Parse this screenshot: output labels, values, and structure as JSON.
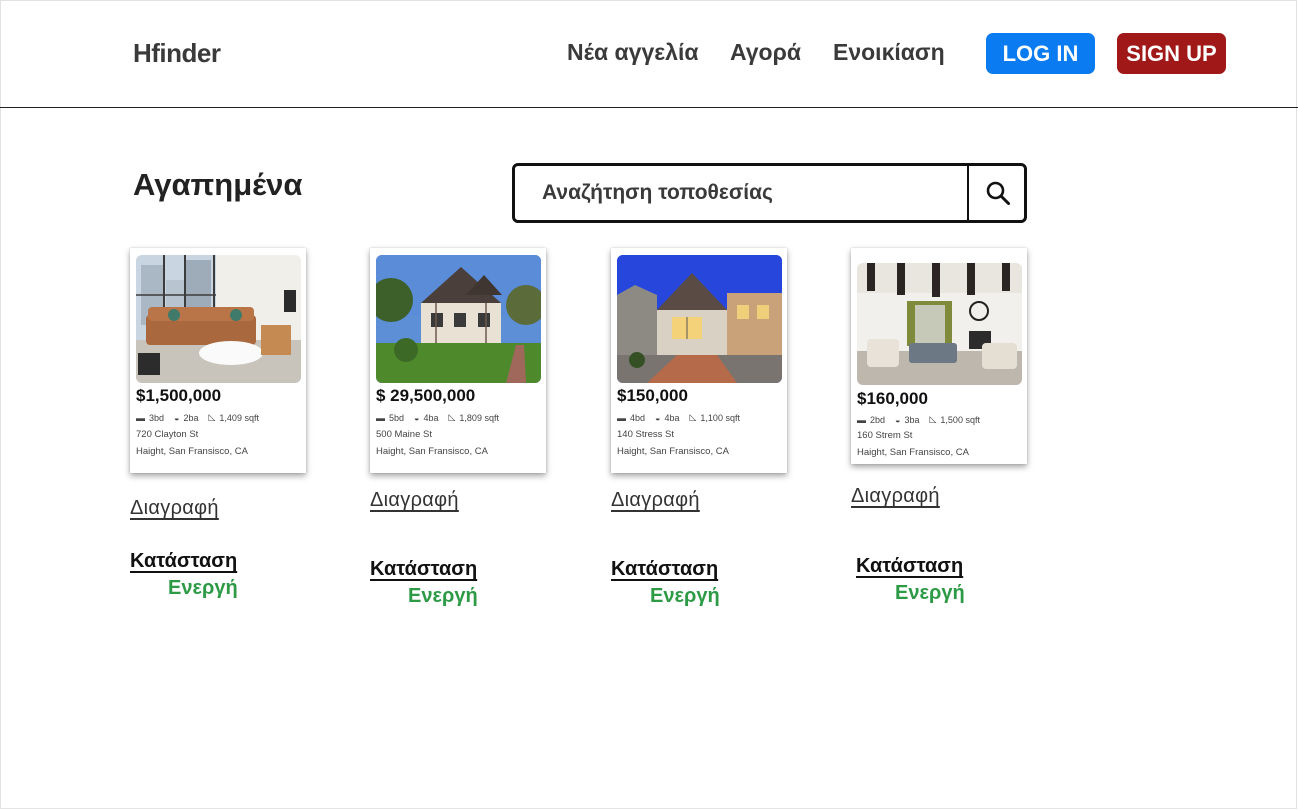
{
  "header": {
    "logo": "Hfinder",
    "nav": {
      "new_listing": "Νέα αγγελία",
      "buy": "Αγορά",
      "rent": "Ενοικίαση"
    },
    "login_label": "LOG IN",
    "signup_label": "SIGN UP",
    "colors": {
      "login": "#0a7bf0",
      "signup": "#a01818"
    }
  },
  "page": {
    "title": "Αγαπημένα"
  },
  "search": {
    "placeholder": "Αναζήτηση τοποθεσίας",
    "icon": "search-icon"
  },
  "listings": [
    {
      "price": "$1,500,000",
      "beds": "3bd",
      "baths": "2ba",
      "area": "1,409 sqft",
      "address": "720 Clayton St",
      "city": "Haight, San Fransisco, CA",
      "photo": "living-room-photo",
      "delete_label": "Διαγραφή",
      "status_label": "Κατάσταση",
      "status_value": "Ενεργή"
    },
    {
      "price": "$ 29,500,000",
      "beds": "5bd",
      "baths": "4ba",
      "area": "1,809 sqft",
      "address": "500 Maine St",
      "city": "Haight, San Fransisco, CA",
      "photo": "tudor-house-photo",
      "delete_label": "Διαγραφή",
      "status_label": "Κατάσταση",
      "status_value": "Ενεργή"
    },
    {
      "price": "$150,000",
      "beds": "4bd",
      "baths": "4ba",
      "area": "1,100 sqft",
      "address": "140 Stress St",
      "city": "Haight, San Fransisco, CA",
      "photo": "twilight-house-photo",
      "delete_label": "Διαγραφή",
      "status_label": "Κατάσταση",
      "status_value": "Ενεργή"
    },
    {
      "price": "$160,000",
      "beds": "2bd",
      "baths": "3ba",
      "area": "1,500 sqft",
      "address": "160 Strem St",
      "city": "Haight, San Fransisco, CA",
      "photo": "beamed-living-room-photo",
      "delete_label": "Διαγραφή",
      "status_label": "Κατάσταση",
      "status_value": "Ενεργή"
    }
  ],
  "colors": {
    "status_active": "#2d9a46"
  }
}
